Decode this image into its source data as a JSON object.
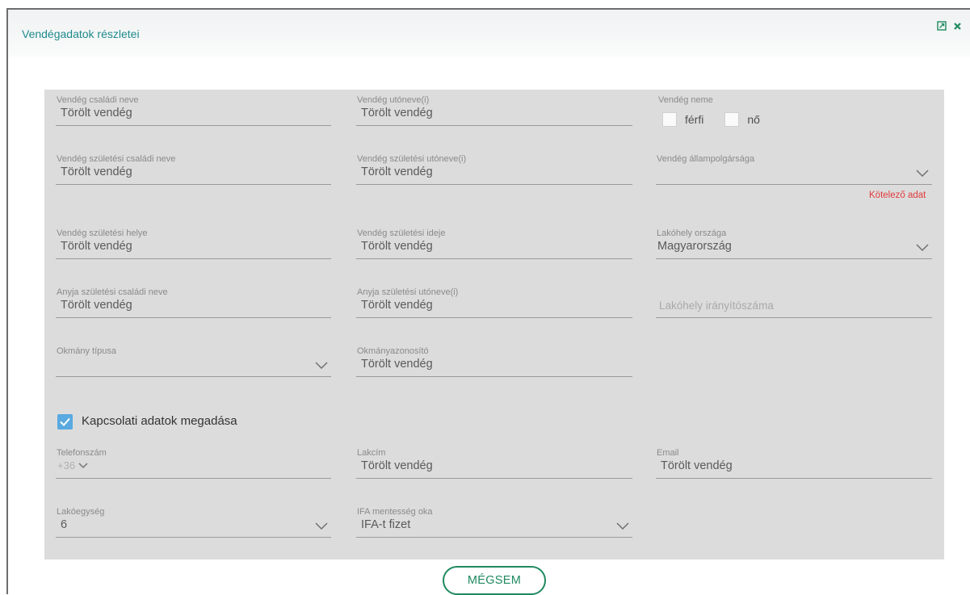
{
  "dialog": {
    "title": "Vendégadatok részletei",
    "icons": [
      "expand-icon",
      "close-icon"
    ]
  },
  "form": {
    "family_name": {
      "label": "Vendég családi neve",
      "value": "Törölt vendég"
    },
    "given_name": {
      "label": "Vendég utóneve(i)",
      "value": "Törölt vendég"
    },
    "gender": {
      "label": "Vendég neme",
      "options": [
        "férfi",
        "nő"
      ]
    },
    "birth_family_name": {
      "label": "Vendég születési családi neve",
      "value": "Törölt vendég"
    },
    "birth_given_name": {
      "label": "Vendég születési utóneve(i)",
      "value": "Törölt vendég"
    },
    "citizenship": {
      "label": "Vendég állampolgársága",
      "value": "",
      "error": "Kötelező adat"
    },
    "birth_place": {
      "label": "Vendég születési helye",
      "value": "Törölt vendég"
    },
    "birth_date": {
      "label": "Vendég születési ideje",
      "value": "Törölt vendég"
    },
    "residence_country": {
      "label": "Lakóhely országa",
      "value": "Magyarország"
    },
    "mother_family_name": {
      "label": "Anyja születési családi neve",
      "value": "Törölt vendég"
    },
    "mother_given_name": {
      "label": "Anyja születési utóneve(i)",
      "value": "Törölt vendég"
    },
    "residence_zip": {
      "placeholder": "Lakóhely irányítószáma"
    },
    "doc_type": {
      "label": "Okmány típusa",
      "value": ""
    },
    "doc_id": {
      "label": "Okmányazonosító",
      "value": "Törölt vendég"
    },
    "contact_checkbox": {
      "label": "Kapcsolati adatok megadása",
      "checked": true
    },
    "phone": {
      "label": "Telefonszám",
      "code": "+36"
    },
    "address": {
      "label": "Lakcím",
      "value": "Törölt vendég"
    },
    "email": {
      "label": "Email",
      "value": "Törölt vendég"
    },
    "unit": {
      "label": "Lakóegység",
      "value": "6"
    },
    "vat_reason": {
      "label": "IFA mentesség oka",
      "value": "IFA-t fizet"
    }
  },
  "buttons": {
    "cancel": "MÉGSEM"
  },
  "colors": {
    "accent": "#1f8a5f",
    "title": "#1f8a8c",
    "error": "#e33a3a",
    "checkbox": "#5aa9e0",
    "panel": "#dcdcdc"
  }
}
